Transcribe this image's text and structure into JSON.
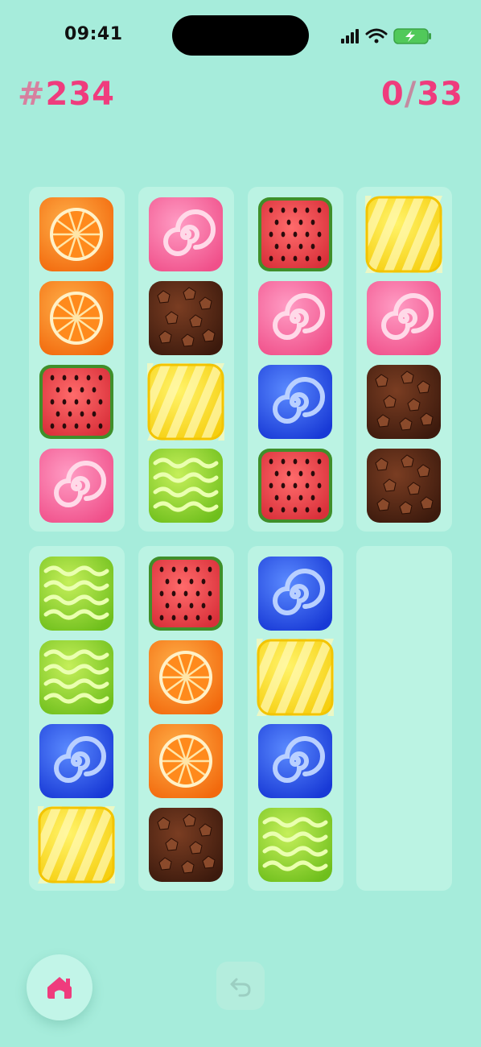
{
  "status_bar": {
    "time": "09:41",
    "icons": [
      "signal-icon",
      "wifi-icon",
      "battery-charging-icon"
    ]
  },
  "header": {
    "level_hash": "#",
    "level_number": "234",
    "progress_done": "0",
    "progress_separator": "/",
    "progress_total": "33"
  },
  "board": {
    "columns": [
      [
        "orange",
        "orange",
        "watermelon",
        "pink-swirl"
      ],
      [
        "pink-swirl",
        "chocolate",
        "yellow-stripe",
        "green-wave"
      ],
      [
        "watermelon",
        "pink-swirl",
        "blue-swirl",
        "watermelon"
      ],
      [
        "yellow-stripe",
        "pink-swirl",
        "chocolate",
        "chocolate"
      ],
      [
        "green-wave",
        "green-wave",
        "blue-swirl",
        "yellow-stripe"
      ],
      [
        "watermelon",
        "orange",
        "orange",
        "chocolate"
      ],
      [
        "blue-swirl",
        "yellow-stripe",
        "blue-swirl",
        "green-wave"
      ],
      []
    ]
  },
  "controls": {
    "home_icon": "home-icon",
    "undo_icon": "undo-icon"
  },
  "colors": {
    "background": "#a6ecdb",
    "column": "#bbf3e3",
    "accent": "#ef3c7d"
  }
}
